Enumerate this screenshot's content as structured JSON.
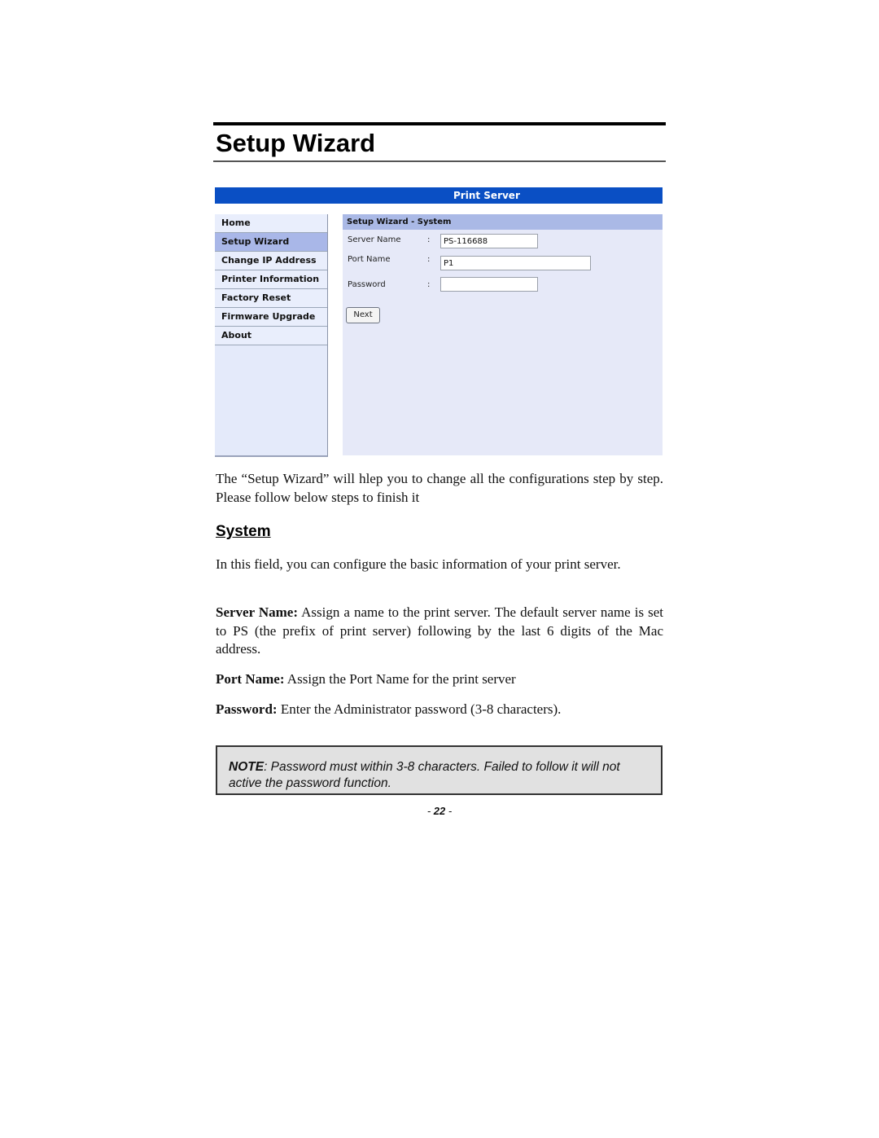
{
  "document": {
    "title": "Setup Wizard",
    "intro": "The “Setup Wizard” will hlep you to change all the configurations step by step. Please follow below steps to finish it",
    "section_heading": "System",
    "section_intro": "In this field, you can configure the basic information of your print server.",
    "definitions": [
      {
        "term": "Server Name:",
        "text": " Assign a name to the print server. The default server name is set to PS (the prefix of print server) following by the last 6 digits of the Mac address."
      },
      {
        "term": "Port Name:",
        "text": " Assign the Port Name for the print server"
      },
      {
        "term": "Password:",
        "text": " Enter the Administrator password (3-8 characters)."
      }
    ],
    "note": {
      "label": "NOTE",
      "text": ": Password must within 3-8 characters. Failed to follow it will not active the password function."
    },
    "page_number": {
      "prefix": "- ",
      "number": "22",
      "suffix": " -"
    }
  },
  "ui": {
    "header_title": "Print Server",
    "nav": {
      "items": [
        {
          "label": "Home"
        },
        {
          "label": "Setup Wizard",
          "active": true
        },
        {
          "label": "Change IP Address"
        },
        {
          "label": "Printer Information"
        },
        {
          "label": "Factory Reset"
        },
        {
          "label": "Firmware Upgrade"
        },
        {
          "label": "About"
        }
      ]
    },
    "panel": {
      "title": "Setup Wizard - System",
      "fields": [
        {
          "label": "Server Name",
          "separator": ":",
          "value": ""
        },
        {
          "label": "Port Name",
          "separator": ":",
          "value": ""
        },
        {
          "label": "Password",
          "separator": ":",
          "value": ""
        }
      ],
      "values": {
        "server_name": "PS-116688",
        "port_name": "P1",
        "password": ""
      },
      "next_label": "Next"
    },
    "colors": {
      "header_bg": "#0a4fc4",
      "nav_bg": "#e9eefc",
      "nav_active_bg": "#a9b7e8",
      "panel_bg": "#e6e9f8",
      "panel_title_bg": "#aab9e6"
    }
  }
}
